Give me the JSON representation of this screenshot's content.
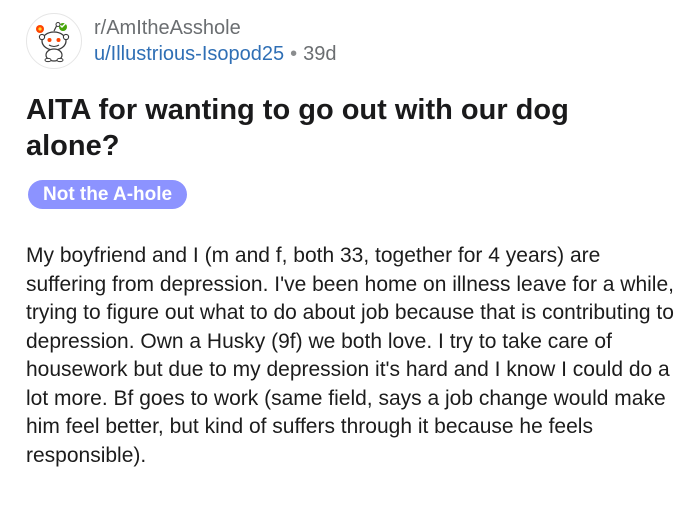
{
  "post": {
    "subreddit": "r/AmItheAsshole",
    "author": "u/Illustrious-Isopod25",
    "separator": "•",
    "age": "39d",
    "avatar_icon": "reddit-snoo-icon",
    "title": "AITA for wanting to go out with our dog alone?",
    "flair": "Not the A-hole",
    "flair_color": "#8c93ff",
    "body": "My boyfriend and I (m and f, both 33, together for 4 years) are suffering from depression. I've been home on illness leave for a while, trying to figure out what to do about job because that is contributing to depression. Own a Husky (9f) we both love. I try to take care of housework but due to my depression it's hard and I know I could do a lot more. Bf goes to work (same field, says a job change would make him feel better, but kind of suffers through it because he feels responsible)."
  }
}
